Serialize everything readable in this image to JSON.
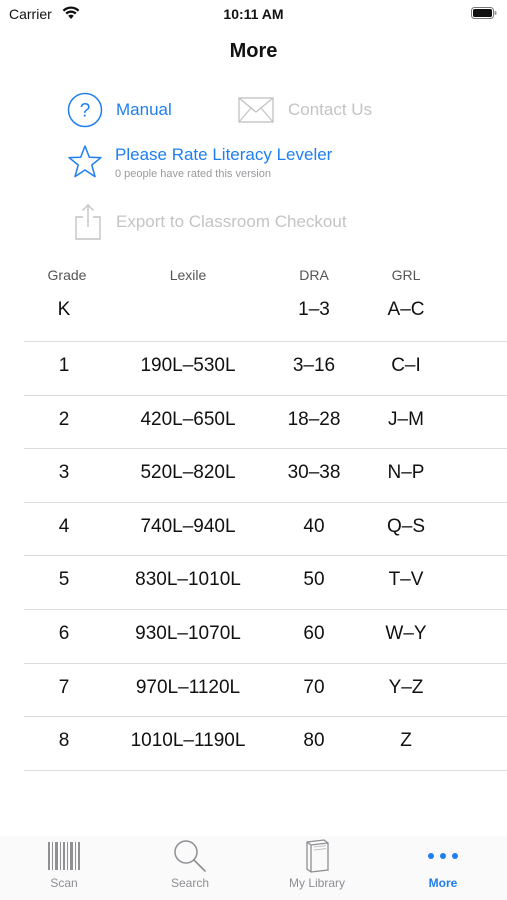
{
  "status_bar": {
    "carrier": "Carrier",
    "time": "10:11 AM"
  },
  "nav": {
    "title": "More"
  },
  "actions": {
    "manual": "Manual",
    "contact": "Contact Us",
    "rate_title": "Please Rate Literacy Leveler",
    "rate_subtitle": "0 people have rated this version",
    "export": "Export to Classroom Checkout"
  },
  "table": {
    "headers": {
      "grade": "Grade",
      "lexile": "Lexile",
      "dra": "DRA",
      "grl": "GRL"
    },
    "rows": [
      {
        "grade": "K",
        "lexile": "",
        "dra": "1–3",
        "grl": "A–C"
      },
      {
        "grade": "1",
        "lexile": "190L–530L",
        "dra": "3–16",
        "grl": "C–I"
      },
      {
        "grade": "2",
        "lexile": "420L–650L",
        "dra": "18–28",
        "grl": "J–M"
      },
      {
        "grade": "3",
        "lexile": "520L–820L",
        "dra": "30–38",
        "grl": "N–P"
      },
      {
        "grade": "4",
        "lexile": "740L–940L",
        "dra": "40",
        "grl": "Q–S"
      },
      {
        "grade": "5",
        "lexile": "830L–1010L",
        "dra": "50",
        "grl": "T–V"
      },
      {
        "grade": "6",
        "lexile": "930L–1070L",
        "dra": "60",
        "grl": "W–Y"
      },
      {
        "grade": "7",
        "lexile": "970L–1120L",
        "dra": "70",
        "grl": "Y–Z"
      },
      {
        "grade": "8",
        "lexile": "1010L–1190L",
        "dra": "80",
        "grl": "Z"
      }
    ]
  },
  "tabbar": {
    "tabs": [
      {
        "label": "Scan",
        "icon": "barcode-icon"
      },
      {
        "label": "Search",
        "icon": "magnifier-icon"
      },
      {
        "label": "My Library",
        "icon": "books-icon"
      },
      {
        "label": "More",
        "icon": "more-dots-icon",
        "active": true
      }
    ]
  },
  "colors": {
    "accent": "#1f7ff0",
    "disabled": "#c4c4c6",
    "tab_inactive": "#8e8e93"
  }
}
